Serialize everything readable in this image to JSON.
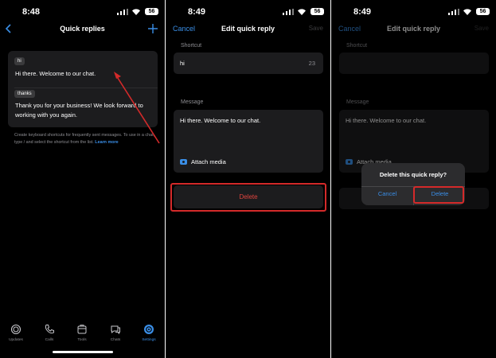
{
  "status": {
    "panel1_time": "8:48",
    "panel2_time": "8:49",
    "panel3_time": "8:49",
    "battery": "56"
  },
  "quick_replies_screen": {
    "title": "Quick replies",
    "replies": [
      {
        "shortcut": "hi",
        "message": "Hi there. Welcome to our chat."
      },
      {
        "shortcut": "thanks",
        "message": "Thank you for your business! We look forward to working with you again."
      }
    ],
    "hint": "Create keyboard shortcuts for frequently sent messages. To use in a chat, type / and select the shortcut from the list.",
    "learn_more": "Learn more",
    "tabs": [
      {
        "label": "Updates",
        "icon": "updates-icon"
      },
      {
        "label": "Calls",
        "icon": "phone-icon"
      },
      {
        "label": "Tools",
        "icon": "tools-icon"
      },
      {
        "label": "Chats",
        "icon": "chats-icon"
      },
      {
        "label": "Settings",
        "icon": "settings-icon",
        "active": true
      }
    ]
  },
  "edit_screen": {
    "cancel": "Cancel",
    "title": "Edit quick reply",
    "save": "Save",
    "shortcut_label": "Shortcut",
    "shortcut_value": "hi",
    "char_count": "23",
    "message_label": "Message",
    "message_value": "Hi there. Welcome to our chat.",
    "attach_media": "Attach media",
    "delete": "Delete"
  },
  "confirm_dialog": {
    "title": "Delete this quick reply?",
    "cancel": "Cancel",
    "delete": "Delete"
  },
  "colors": {
    "accent": "#3a8ee6",
    "destructive": "#e0443e",
    "annotation": "#d42a2a"
  }
}
